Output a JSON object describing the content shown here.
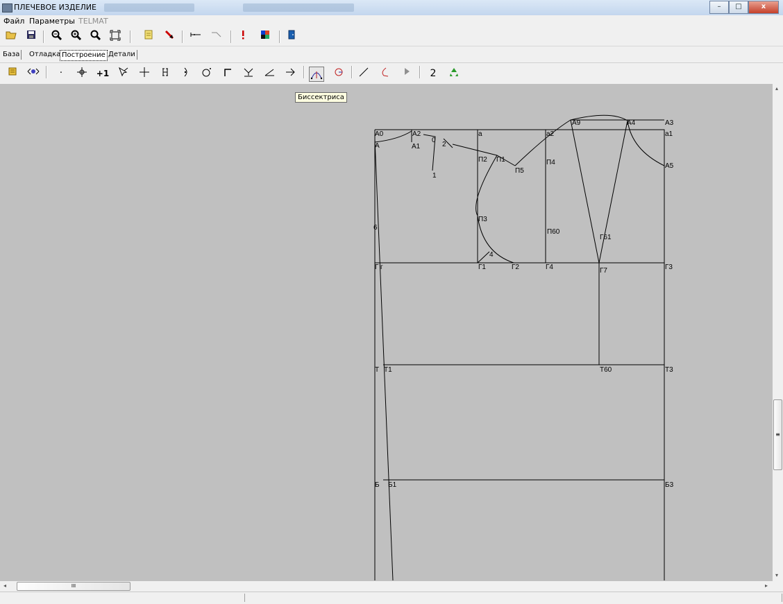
{
  "window": {
    "title": "ПЛЕЧЕВОЕ ИЗДЕЛИЕ",
    "minimize": "–",
    "maximize": "□",
    "close": "x"
  },
  "menu": {
    "file": "Файл",
    "params": "Параметры",
    "telmat": "TELMAT"
  },
  "tabs": [
    "База",
    "Отладка",
    "Построение",
    "Детали"
  ],
  "active_tab": "Построение",
  "toolbar_icons": [
    "open-icon",
    "save-icon",
    "zoom-out-icon",
    "zoom-in-icon",
    "zoom-icon",
    "fit-window-icon",
    "page-icon",
    "pointer-arrow-icon",
    "measure-line-icon",
    "measure-diagonal-icon",
    "exclamation-icon",
    "colors-icon",
    "exit-door-icon"
  ],
  "construction_tools": {
    "point_symbol": "·",
    "point_plus": "+1",
    "count_label": "2",
    "icons": [
      "book-icon",
      "eye-icon",
      "point-icon",
      "move-icon",
      "point-plus-icon",
      "select-icon",
      "cross-icon",
      "bracket-icon",
      "arc-point-icon",
      "circle-point-icon",
      "corner-icon",
      "bisector-angle-icon",
      "angle-icon",
      "arrow-icon",
      "bisector-icon",
      "circle-icon",
      "line-icon",
      "curve-icon",
      "play-icon",
      "number-icon",
      "recycle-icon"
    ]
  },
  "tooltip": "Биссектриса",
  "drawing": {
    "point_labels": [
      "А0",
      "А2",
      "А",
      "А1",
      "0",
      "1",
      "2",
      "а",
      "П2",
      "П1",
      "П5",
      "а2",
      "П4",
      "А9",
      "А4",
      "А3",
      "а1",
      "А5",
      "П3",
      "П60",
      "Г61",
      "4",
      "Г",
      "г",
      "Г1",
      "Г2",
      "Г4",
      "Г7",
      "Г3",
      "Т",
      "Т1",
      "Т60",
      "Т3",
      "Б",
      "Б1",
      "Б3",
      "6"
    ]
  },
  "scroll": {
    "grip": "≡",
    "hgrip": "III",
    "left": "◂",
    "right": "▸",
    "up": "▴",
    "down": "▾"
  }
}
